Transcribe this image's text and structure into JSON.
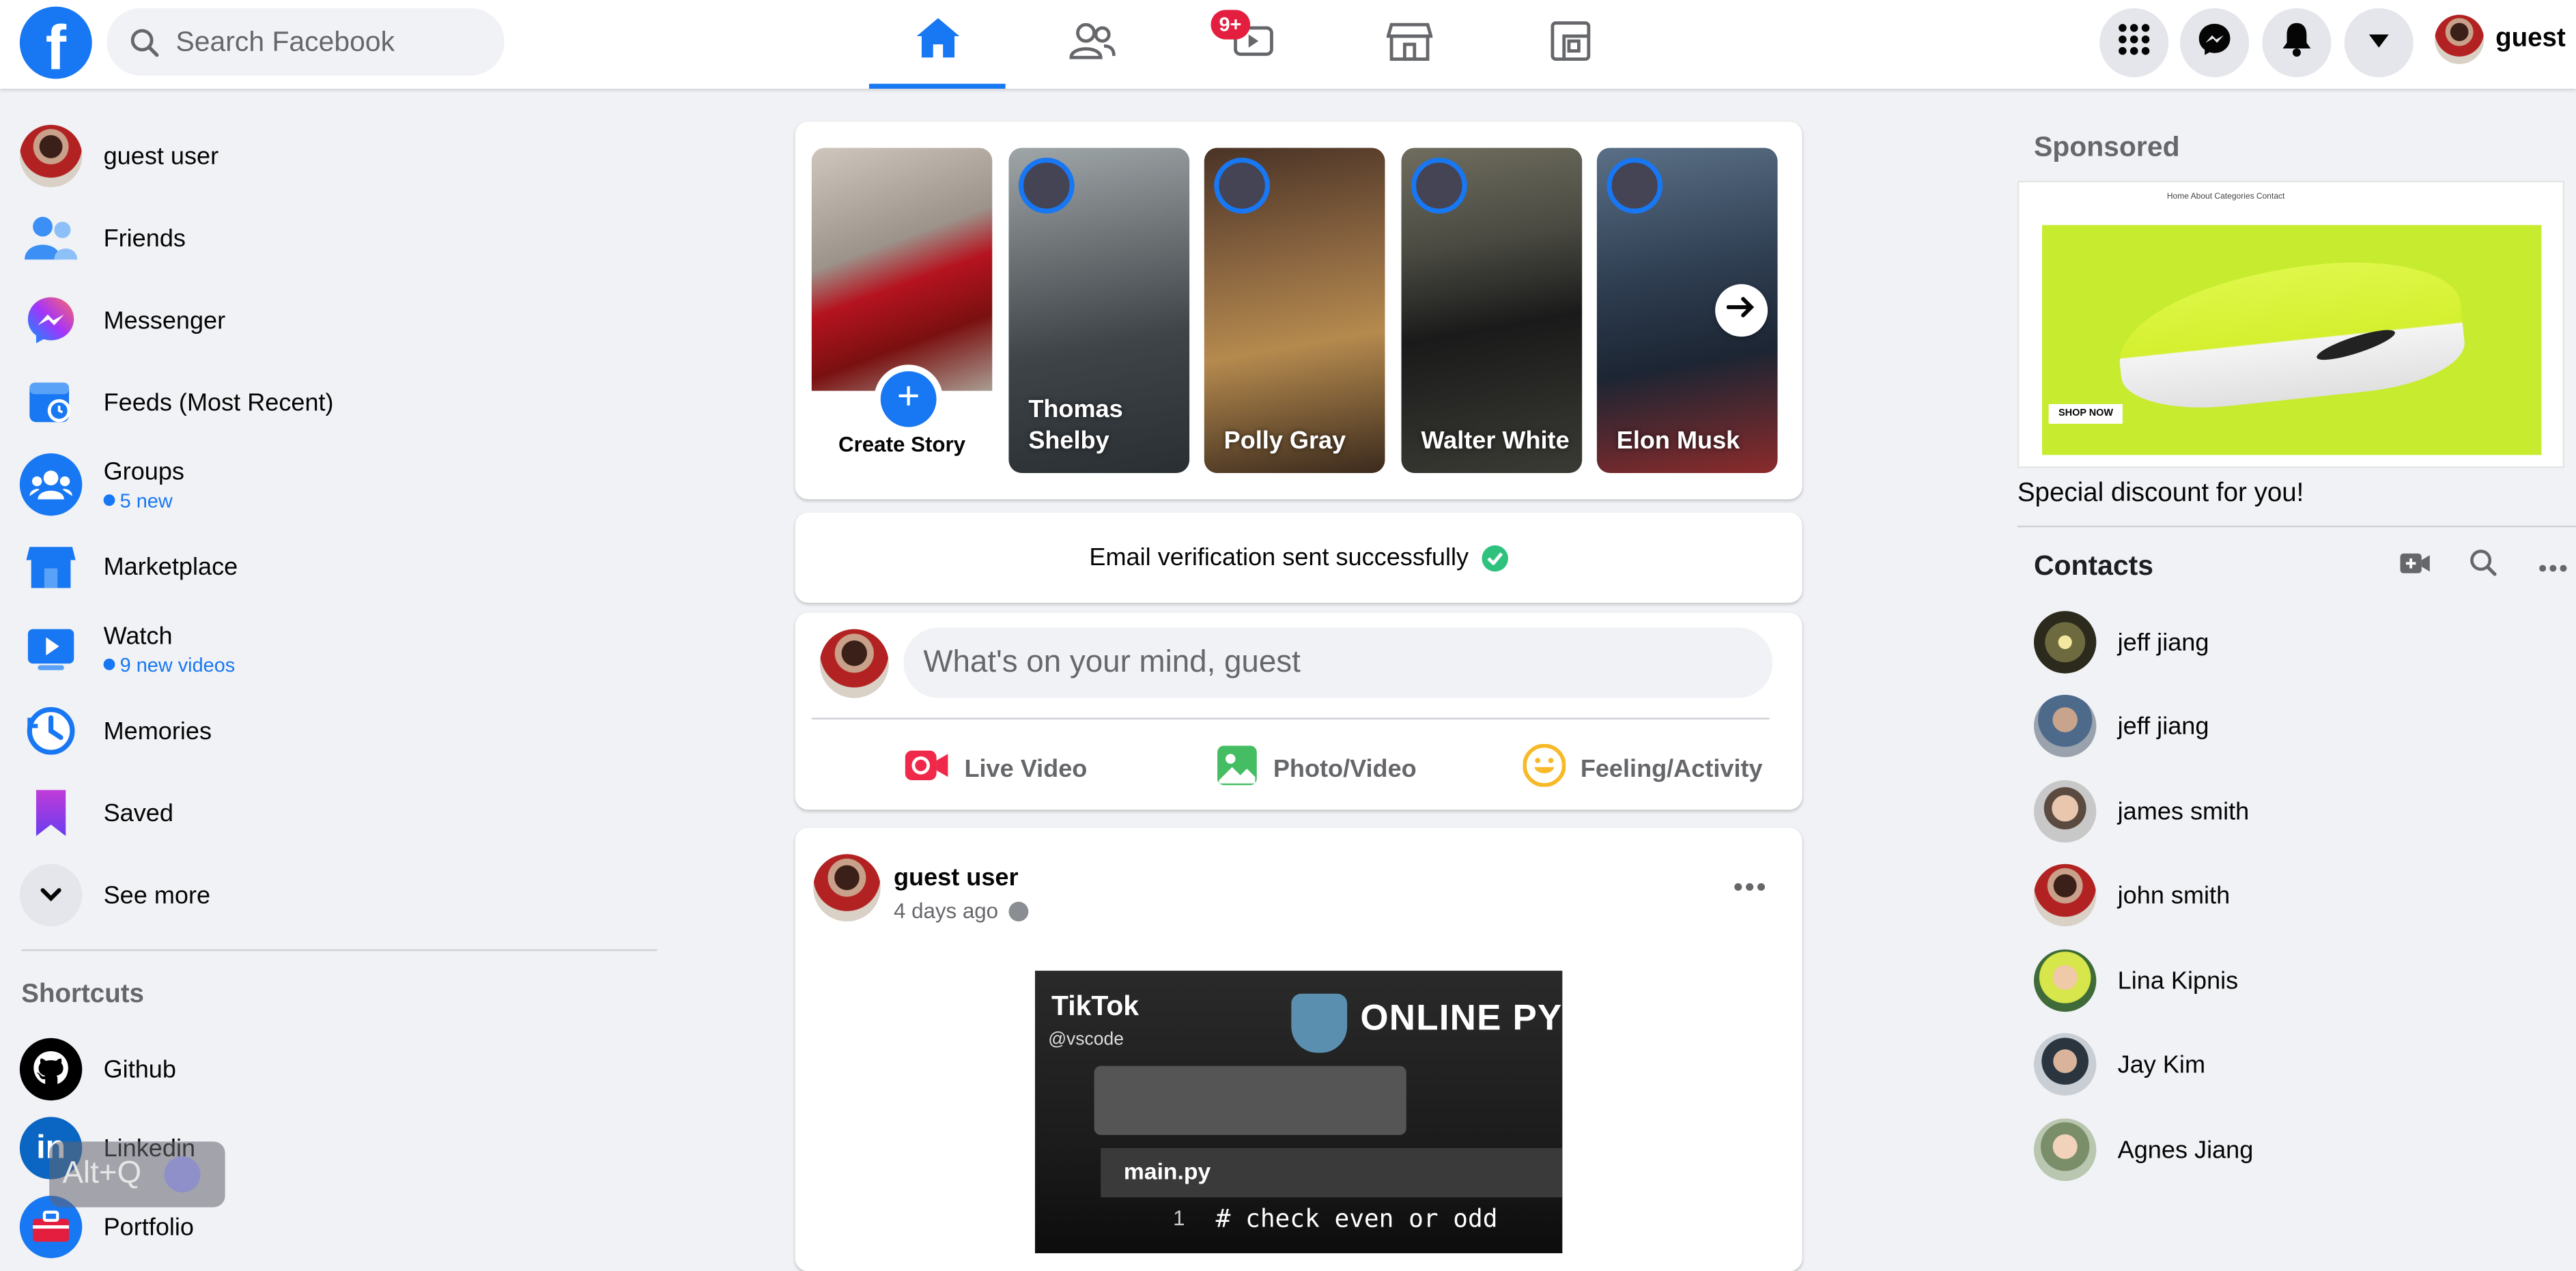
{
  "header": {
    "logo_letter": "f",
    "search_placeholder": "Search Facebook",
    "notification_badge": "9+",
    "profile_name": "guest",
    "brand_color": "#1877f2"
  },
  "sidebar": {
    "items": [
      {
        "label": "guest user"
      },
      {
        "label": "Friends"
      },
      {
        "label": "Messenger"
      },
      {
        "label": "Feeds (Most Recent)"
      },
      {
        "label": "Groups",
        "sub": "5 new"
      },
      {
        "label": "Marketplace"
      },
      {
        "label": "Watch",
        "sub": "9 new videos"
      },
      {
        "label": "Memories"
      },
      {
        "label": "Saved"
      },
      {
        "label": "See more"
      }
    ],
    "shortcuts_title": "Shortcuts",
    "shortcuts": [
      {
        "label": "Github"
      },
      {
        "label": "Linkedin"
      },
      {
        "label": "Portfolio"
      }
    ],
    "overlay_hotkey": "Alt+Q"
  },
  "stories": {
    "create_label": "Create Story",
    "create_plus": "+",
    "items": [
      {
        "name": "Thomas Shelby"
      },
      {
        "name": "Polly Gray"
      },
      {
        "name": "Walter White"
      },
      {
        "name": "Elon Musk"
      }
    ]
  },
  "notice": {
    "text": "Email verification sent successfully"
  },
  "composer": {
    "placeholder": "What's on your mind, guest",
    "actions": [
      {
        "label": "Live Video",
        "icon": "live-video-icon"
      },
      {
        "label": "Photo/Video",
        "icon": "photo-icon"
      },
      {
        "label": "Feeling/Activity",
        "icon": "smiley-icon"
      }
    ]
  },
  "post": {
    "author": "guest user",
    "time": "4 days ago",
    "video": {
      "brand": "TikTok",
      "handle": "@vscode",
      "banner": "ONLINE PYT",
      "tab": "main.py",
      "line_no": "1",
      "code": "# check even or odd"
    }
  },
  "right": {
    "sponsored_title": "Sponsored",
    "ad_caption": "Special discount for you!",
    "ad_cta": "SHOP NOW",
    "ad_nav": "Home   About   Categories   Contact",
    "contacts_title": "Contacts",
    "contacts": [
      {
        "name": "jeff jiang"
      },
      {
        "name": "jeff jiang"
      },
      {
        "name": "james smith"
      },
      {
        "name": "john smith"
      },
      {
        "name": "Lina Kipnis"
      },
      {
        "name": "Jay Kim"
      },
      {
        "name": "Agnes Jiang"
      }
    ]
  }
}
